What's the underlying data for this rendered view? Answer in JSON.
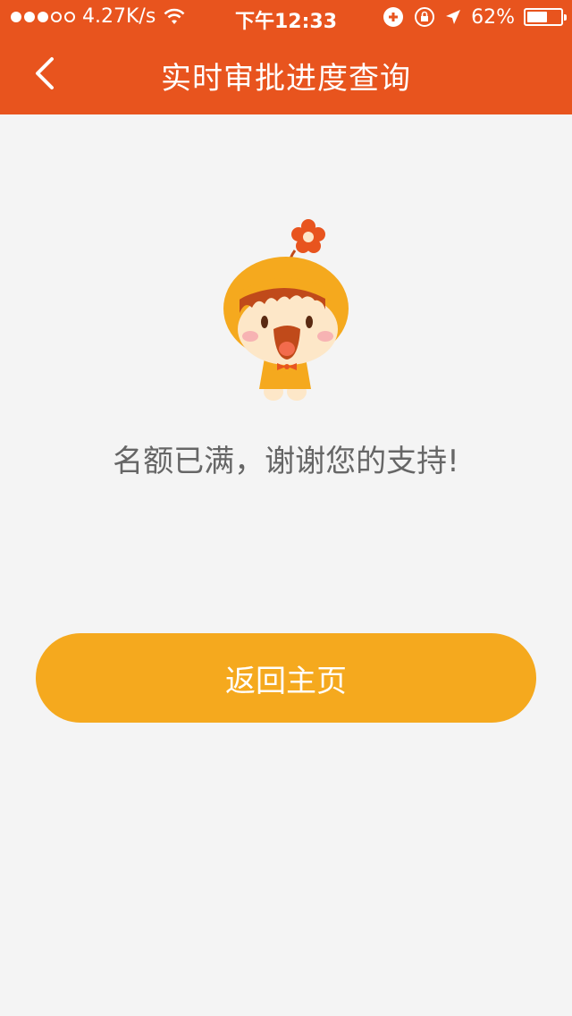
{
  "status_bar": {
    "network_speed": "4.27K/s",
    "time": "下午12:33",
    "battery_percent": "62%",
    "battery_level": 0.62,
    "signal_strength": 3
  },
  "header": {
    "title": "实时审批进度查询",
    "back_icon": "chevron-left-icon"
  },
  "main": {
    "message": "名额已满，谢谢您的支持!",
    "home_button_label": "返回主页",
    "mascot_icon": "flower-mascot-icon"
  },
  "colors": {
    "header": "#e8541e",
    "button": "#f5a91e",
    "background": "#f4f4f4",
    "message_text": "#666666"
  }
}
